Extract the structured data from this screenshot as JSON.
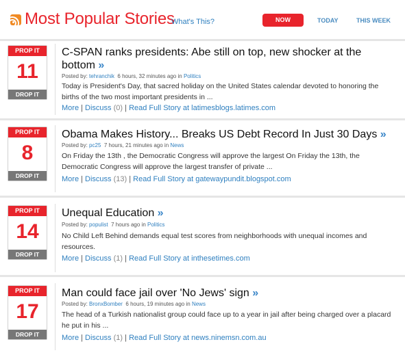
{
  "header": {
    "title": "Most Popular Stories",
    "whats_this": "What's This?",
    "tabs": [
      "NOW",
      "TODAY",
      "THIS WEEK"
    ]
  },
  "vote": {
    "prop_label": "PROP IT",
    "drop_label": "DROP IT",
    "raquo": "»"
  },
  "stories": [
    {
      "count": "11",
      "headline": "C-SPAN ranks presidents: Abe still on top, new shocker at the bottom",
      "posted_by_label": "Posted by:",
      "user": "tehranchik",
      "time": "6 hours, 32 minutes ago in",
      "category": "Politics",
      "summary": "Today is President's Day, that sacred holiday on the United States calendar devoted to honoring the births of the two most important presidents in ...",
      "more": "More",
      "discuss": "Discuss",
      "comments": "(0)",
      "read_full": "Read Full Story at latimesblogs.latimes.com"
    },
    {
      "count": "8",
      "headline": "Obama Makes History... Breaks US Debt Record In Just 30 Days",
      "posted_by_label": "Posted by:",
      "user": "pc25",
      "time": "7 hours, 21 minutes ago in",
      "category": "News",
      "summary": "On Friday the 13th , the Democratic Congress will approve the largest On Friday the 13th, the Democratic Congress will approve the largest transfer of private ...",
      "more": "More",
      "discuss": "Discuss",
      "comments": "(13)",
      "read_full": "Read Full Story at gatewaypundit.blogspot.com"
    },
    {
      "count": "14",
      "headline": "Unequal Education",
      "posted_by_label": "Posted by:",
      "user": "populist",
      "time": "7 hours ago in",
      "category": "Politics",
      "summary": "No Child Left Behind demands equal test scores from neighborhoods with unequal incomes and resources.",
      "more": "More",
      "discuss": "Discuss",
      "comments": "(1)",
      "read_full": "Read Full Story at inthesetimes.com"
    },
    {
      "count": "17",
      "headline": "Man could face jail over 'No Jews' sign",
      "posted_by_label": "Posted by:",
      "user": "BronxBomber",
      "time": "6 hours, 19 minutes ago in",
      "category": "News",
      "summary": "The head of a Turkish nationalist group could face up to a year in jail after being charged over a placard he put in his ...",
      "more": "More",
      "discuss": "Discuss",
      "comments": "(1)",
      "read_full": "Read Full Story at news.ninemsn.com.au"
    }
  ]
}
